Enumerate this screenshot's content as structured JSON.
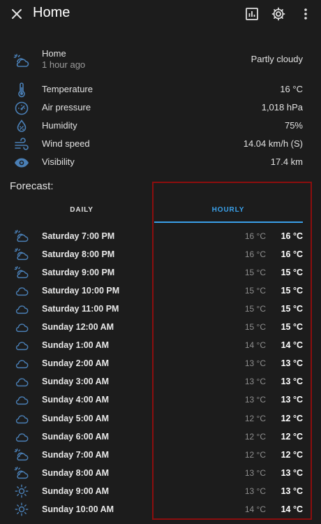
{
  "header": {
    "title": "Home"
  },
  "current": {
    "location": "Home",
    "updated": "1 hour ago",
    "condition": "Partly cloudy"
  },
  "attributes": [
    {
      "label": "Temperature",
      "value": "16 °C",
      "icon": "thermometer-icon"
    },
    {
      "label": "Air pressure",
      "value": "1,018 hPa",
      "icon": "gauge-icon"
    },
    {
      "label": "Humidity",
      "value": "75%",
      "icon": "water-percent-icon"
    },
    {
      "label": "Wind speed",
      "value": "14.04 km/h (S)",
      "icon": "wind-icon"
    },
    {
      "label": "Visibility",
      "value": "17.4 km",
      "icon": "eye-icon"
    }
  ],
  "forecast": {
    "label": "Forecast:",
    "tabs": {
      "daily": "DAILY",
      "hourly": "HOURLY"
    },
    "rows": [
      {
        "time": "Saturday 7:00 PM",
        "low": "16 °C",
        "high": "16 °C",
        "icon": "partly-cloudy-icon"
      },
      {
        "time": "Saturday 8:00 PM",
        "low": "16 °C",
        "high": "16 °C",
        "icon": "partly-cloudy-icon"
      },
      {
        "time": "Saturday 9:00 PM",
        "low": "15 °C",
        "high": "15 °C",
        "icon": "partly-cloudy-icon"
      },
      {
        "time": "Saturday 10:00 PM",
        "low": "15 °C",
        "high": "15 °C",
        "icon": "cloud-icon"
      },
      {
        "time": "Saturday 11:00 PM",
        "low": "15 °C",
        "high": "15 °C",
        "icon": "cloud-icon"
      },
      {
        "time": "Sunday 12:00 AM",
        "low": "15 °C",
        "high": "15 °C",
        "icon": "cloud-icon"
      },
      {
        "time": "Sunday 1:00 AM",
        "low": "14 °C",
        "high": "14 °C",
        "icon": "cloud-icon"
      },
      {
        "time": "Sunday 2:00 AM",
        "low": "13 °C",
        "high": "13 °C",
        "icon": "cloud-icon"
      },
      {
        "time": "Sunday 3:00 AM",
        "low": "13 °C",
        "high": "13 °C",
        "icon": "cloud-icon"
      },
      {
        "time": "Sunday 4:00 AM",
        "low": "13 °C",
        "high": "13 °C",
        "icon": "cloud-icon"
      },
      {
        "time": "Sunday 5:00 AM",
        "low": "12 °C",
        "high": "12 °C",
        "icon": "cloud-icon"
      },
      {
        "time": "Sunday 6:00 AM",
        "low": "12 °C",
        "high": "12 °C",
        "icon": "cloud-icon"
      },
      {
        "time": "Sunday 7:00 AM",
        "low": "12 °C",
        "high": "12 °C",
        "icon": "partly-cloudy-icon"
      },
      {
        "time": "Sunday 8:00 AM",
        "low": "13 °C",
        "high": "13 °C",
        "icon": "partly-cloudy-icon"
      },
      {
        "time": "Sunday 9:00 AM",
        "low": "13 °C",
        "high": "13 °C",
        "icon": "sunny-icon"
      },
      {
        "time": "Sunday 10:00 AM",
        "low": "14 °C",
        "high": "14 °C",
        "icon": "sunny-icon"
      }
    ]
  },
  "colors": {
    "accent": "#3aa0e9",
    "icon": "#4a7fb5",
    "highlight_border": "#8c0e0e",
    "background": "#1c1c1c"
  }
}
